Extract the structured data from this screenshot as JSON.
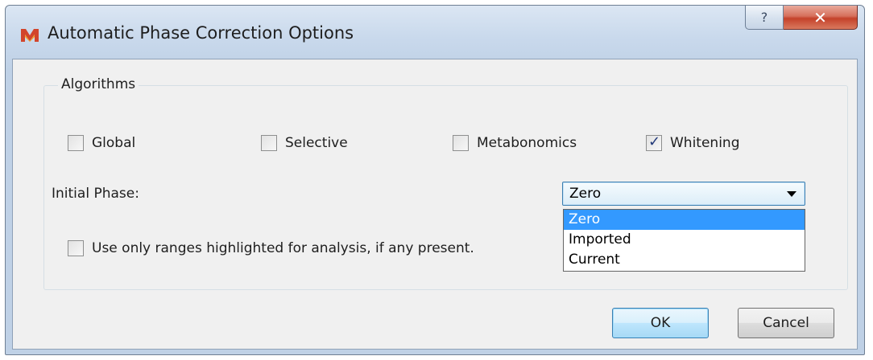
{
  "window": {
    "title": "Automatic Phase Correction Options",
    "help_glyph": "?",
    "close_glyph": "✕"
  },
  "algorithms": {
    "group_label": "Algorithms",
    "options": [
      {
        "label": "Global",
        "checked": false
      },
      {
        "label": "Selective",
        "checked": false
      },
      {
        "label": "Metabonomics",
        "checked": false
      },
      {
        "label": "Whitening",
        "checked": true
      }
    ]
  },
  "initial_phase": {
    "label": "Initial Phase:",
    "selected": "Zero",
    "options": [
      "Zero",
      "Imported",
      "Current"
    ]
  },
  "ranges_option": {
    "label": "Use only ranges highlighted for analysis, if any present.",
    "checked": false
  },
  "buttons": {
    "ok": "OK",
    "cancel": "Cancel"
  },
  "check_glyph": "✓",
  "colors": {
    "selection": "#3399ff",
    "default_button_border": "#3c7fb1",
    "close_button": "#c4412a"
  }
}
